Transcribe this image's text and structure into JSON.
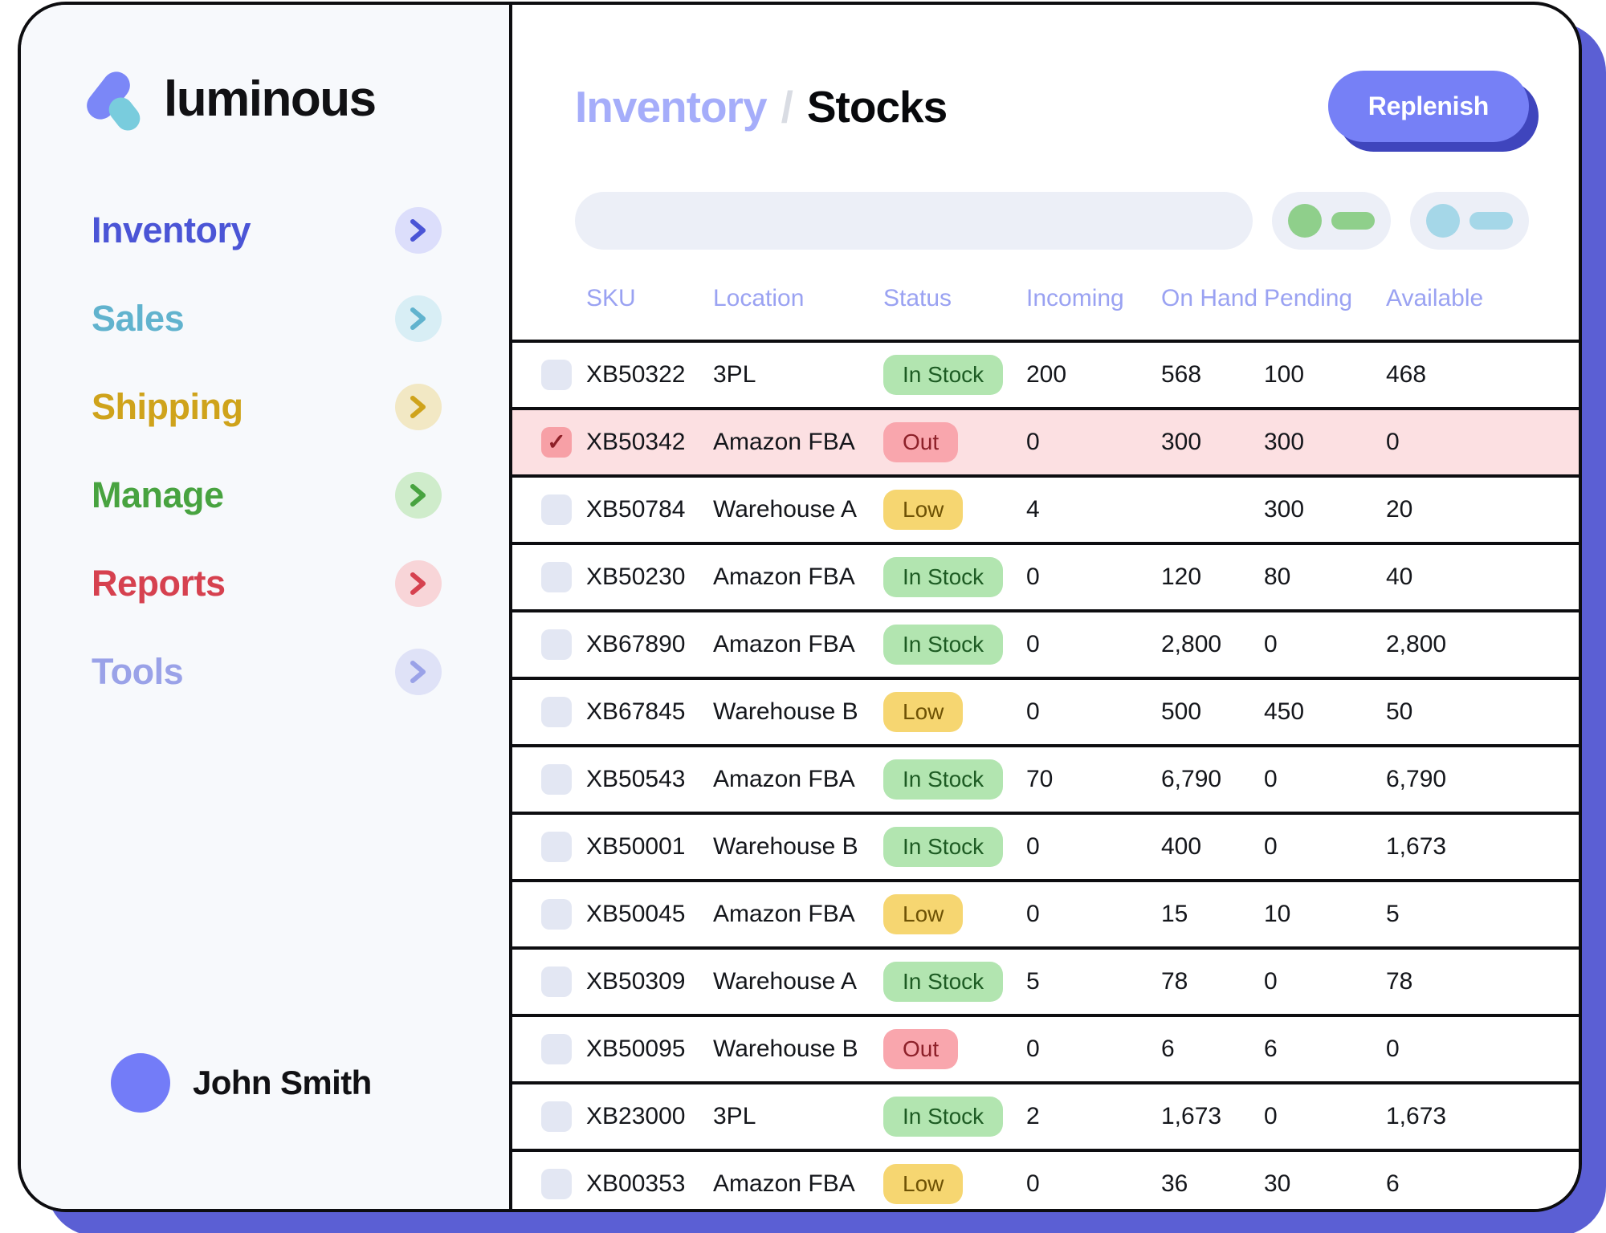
{
  "brand": {
    "name": "luminous"
  },
  "sidebar": {
    "items": [
      {
        "label": "Inventory",
        "color": "#4b55d6",
        "bg": "#dcdefb",
        "arrow": "chevron-right-icon"
      },
      {
        "label": "Sales",
        "color": "#61b3ce",
        "bg": "#d8eef5",
        "arrow": "chevron-right-icon"
      },
      {
        "label": "Shipping",
        "color": "#cfa31b",
        "bg": "#f2e8c4",
        "arrow": "chevron-right-icon"
      },
      {
        "label": "Manage",
        "color": "#48a340",
        "bg": "#cfeccb",
        "arrow": "chevron-right-icon"
      },
      {
        "label": "Reports",
        "color": "#d6414f",
        "bg": "#f8d5d8",
        "arrow": "chevron-right-icon"
      },
      {
        "label": "Tools",
        "color": "#9aa2e8",
        "bg": "#dfe2f7",
        "arrow": "chevron-right-icon"
      }
    ],
    "profile": {
      "name": "John Smith"
    }
  },
  "header": {
    "breadcrumb_parent": "Inventory",
    "breadcrumb_separator": "/",
    "breadcrumb_current": "Stocks",
    "replenish_label": "Replenish"
  },
  "toolbar": {
    "search_value": "",
    "search_placeholder": "",
    "chips": [
      {
        "name": "filter-chip-green",
        "dot": "#8fcf8b",
        "bar": "#8fcf8b"
      },
      {
        "name": "filter-chip-blue",
        "dot": "#a5d7e8",
        "bar": "#a5d7e8"
      }
    ]
  },
  "table": {
    "columns": [
      "SKU",
      "Location",
      "Status",
      "Incoming",
      "On Hand",
      "Pending",
      "Available"
    ],
    "rows": [
      {
        "checked": false,
        "sku": "XB50322",
        "location": "3PL",
        "status": "In Stock",
        "status_kind": "instock",
        "incoming": "200",
        "on_hand": "568",
        "pending": "100",
        "available": "468"
      },
      {
        "checked": true,
        "sku": "XB50342",
        "location": "Amazon FBA",
        "status": "Out",
        "status_kind": "out",
        "incoming": "0",
        "on_hand": "300",
        "pending": "300",
        "available": "0"
      },
      {
        "checked": false,
        "sku": "XB50784",
        "location": "Warehouse A",
        "status": "Low",
        "status_kind": "low",
        "incoming": "4",
        "on_hand": "",
        "pending": "300",
        "available": "20"
      },
      {
        "checked": false,
        "sku": "XB50230",
        "location": "Amazon FBA",
        "status": "In Stock",
        "status_kind": "instock",
        "incoming": "0",
        "on_hand": "120",
        "pending": "80",
        "available": "40"
      },
      {
        "checked": false,
        "sku": "XB67890",
        "location": "Amazon FBA",
        "status": "In Stock",
        "status_kind": "instock",
        "incoming": "0",
        "on_hand": "2,800",
        "pending": "0",
        "available": "2,800"
      },
      {
        "checked": false,
        "sku": "XB67845",
        "location": "Warehouse B",
        "status": "Low",
        "status_kind": "low",
        "incoming": "0",
        "on_hand": "500",
        "pending": "450",
        "available": "50"
      },
      {
        "checked": false,
        "sku": "XB50543",
        "location": "Amazon FBA",
        "status": "In Stock",
        "status_kind": "instock",
        "incoming": "70",
        "on_hand": "6,790",
        "pending": "0",
        "available": "6,790"
      },
      {
        "checked": false,
        "sku": "XB50001",
        "location": "Warehouse B",
        "status": "In Stock",
        "status_kind": "instock",
        "incoming": "0",
        "on_hand": "400",
        "pending": "0",
        "available": "1,673"
      },
      {
        "checked": false,
        "sku": "XB50045",
        "location": "Amazon FBA",
        "status": "Low",
        "status_kind": "low",
        "incoming": "0",
        "on_hand": "15",
        "pending": "10",
        "available": "5"
      },
      {
        "checked": false,
        "sku": "XB50309",
        "location": "Warehouse A",
        "status": "In Stock",
        "status_kind": "instock",
        "incoming": "5",
        "on_hand": "78",
        "pending": "0",
        "available": "78"
      },
      {
        "checked": false,
        "sku": "XB50095",
        "location": "Warehouse B",
        "status": "Out",
        "status_kind": "out",
        "incoming": "0",
        "on_hand": "6",
        "pending": "6",
        "available": "0"
      },
      {
        "checked": false,
        "sku": "XB23000",
        "location": "3PL",
        "status": "In Stock",
        "status_kind": "instock",
        "incoming": "2",
        "on_hand": "1,673",
        "pending": "0",
        "available": "1,673"
      },
      {
        "checked": false,
        "sku": "XB00353",
        "location": "Amazon FBA",
        "status": "Low",
        "status_kind": "low",
        "incoming": "0",
        "on_hand": "36",
        "pending": "30",
        "available": "6"
      }
    ],
    "checked_mark": "✓"
  },
  "theme": {
    "accent": "#7680f6",
    "accent_dark": "#3f45bd",
    "frame": "#0d0d10",
    "sidebar_bg": "#f7f9fc",
    "selected_row_bg": "#fce0e2"
  }
}
